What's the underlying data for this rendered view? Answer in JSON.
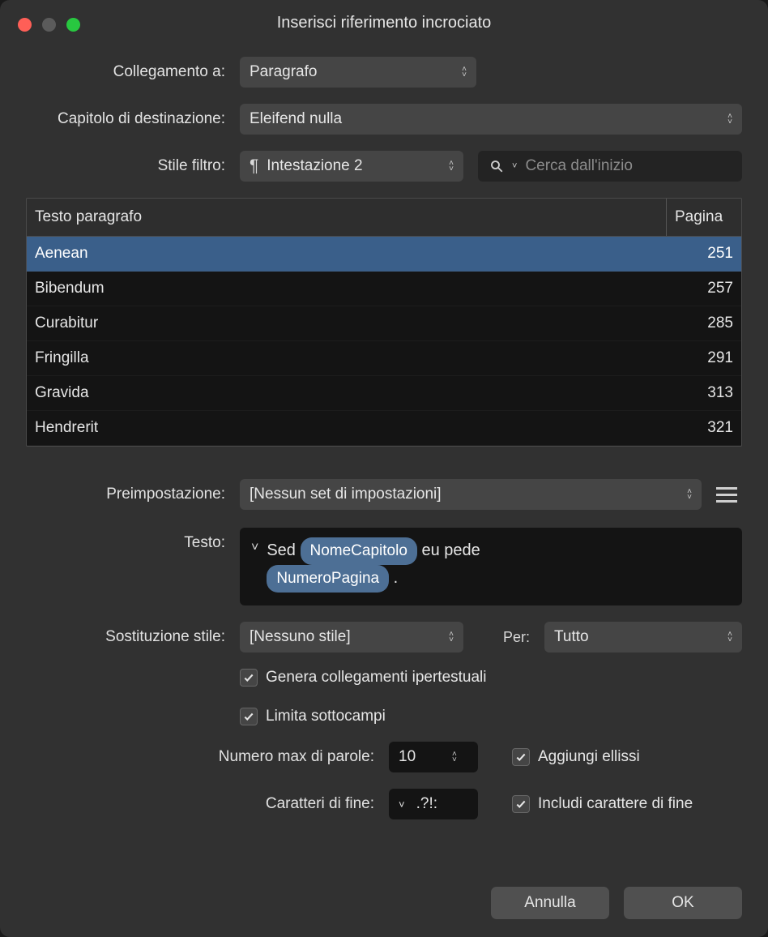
{
  "window": {
    "title": "Inserisci riferimento incrociato"
  },
  "labels": {
    "link_to": "Collegamento a:",
    "destination_chapter": "Capitolo di destinazione:",
    "filter_style": "Stile filtro:",
    "preset": "Preimpostazione:",
    "text": "Testo:",
    "style_sub": "Sostituzione stile:",
    "for": "Per:",
    "max_words": "Numero max di parole:",
    "end_chars": "Caratteri di fine:"
  },
  "dropdowns": {
    "link_to": "Paragrafo",
    "destination_chapter": "Eleifend nulla",
    "filter_style": "Intestazione 2",
    "preset": "[Nessun set di impostazioni]",
    "style_sub": "[Nessuno stile]",
    "for": "Tutto"
  },
  "search": {
    "placeholder": "Cerca dall'inizio"
  },
  "table": {
    "headers": {
      "text": "Testo paragrafo",
      "page": "Pagina"
    },
    "rows": [
      {
        "text": "Aenean",
        "page": "251",
        "selected": true
      },
      {
        "text": "Bibendum",
        "page": "257"
      },
      {
        "text": "Curabitur",
        "page": "285"
      },
      {
        "text": "Fringilla",
        "page": "291"
      },
      {
        "text": "Gravida",
        "page": "313"
      },
      {
        "text": "Hendrerit",
        "page": "321"
      }
    ]
  },
  "editor": {
    "prefix": "Sed ",
    "chip1": "NomeCapitolo",
    "mid": " eu pede ",
    "chip2": "NumeroPagina",
    "suffix": "."
  },
  "checkboxes": {
    "hyperlinks": "Genera collegamenti ipertestuali",
    "limit_subfields": "Limita sottocampi",
    "add_ellipsis": "Aggiungi ellissi",
    "include_end_char": "Includi carattere di fine"
  },
  "numbers": {
    "max_words": "10"
  },
  "end_chars": {
    "value": ".?!:"
  },
  "buttons": {
    "cancel": "Annulla",
    "ok": "OK"
  }
}
